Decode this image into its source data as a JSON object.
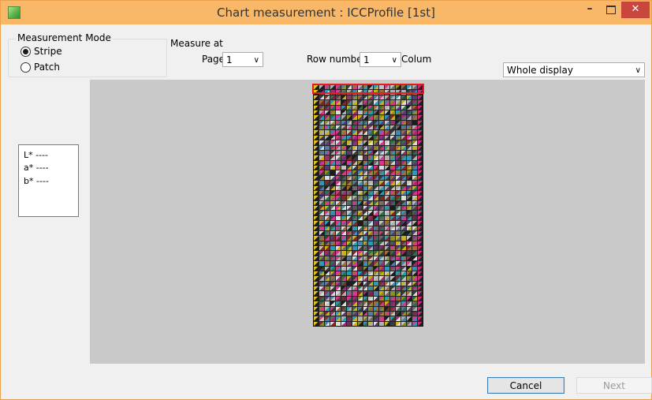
{
  "window": {
    "title": "Chart measurement : ICCProfile [1st]",
    "minimize_glyph": "–",
    "close_glyph": "✕"
  },
  "measurement_mode": {
    "title": "Measurement Mode",
    "options": [
      "Stripe",
      "Patch"
    ],
    "selected": "Stripe"
  },
  "measure_at": {
    "title": "Measure at",
    "page_label": "Page",
    "page_value": "1",
    "row_label": "Row number",
    "row_value": "1",
    "column_label": "Colum"
  },
  "display": {
    "selected": "Whole display"
  },
  "lab_values": {
    "L": "L* ----",
    "a": "a* ----",
    "b": "b* ----"
  },
  "buttons": {
    "cancel": "Cancel",
    "next": "Next"
  },
  "icons": {
    "dropdown": "∨",
    "app": "app-icon"
  },
  "colors": {
    "titlebar": "#f8b868",
    "close_button": "#c9463d",
    "selection_outline": "#e02020",
    "preview_background": "#c9c9c9"
  }
}
